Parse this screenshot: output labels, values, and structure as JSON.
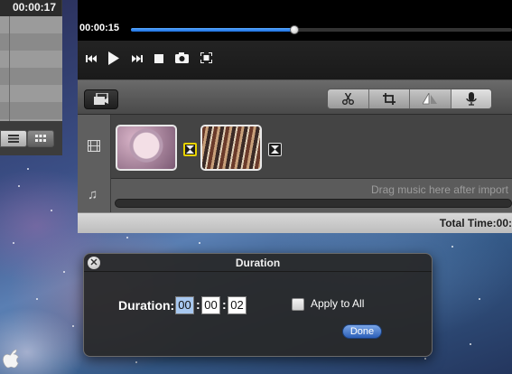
{
  "library": {
    "time": "00:00:17",
    "view_list_icon": "list-view-icon",
    "view_grid_icon": "grid-view-icon"
  },
  "player": {
    "current_time": "00:00:15",
    "progress": 0.43,
    "controls": [
      "previous-icon",
      "play-icon",
      "next-icon",
      "stop-icon",
      "camera-icon",
      "fullscreen-icon"
    ]
  },
  "toolbar": {
    "media_icon": "media-browser-icon",
    "tools": [
      "scissors-icon",
      "crop-icon",
      "effects-icon",
      "microphone-icon"
    ]
  },
  "timeline": {
    "music_hint": "Drag music here after import",
    "total_time_label": "Total Time:00:"
  },
  "duration_dialog": {
    "title": "Duration",
    "label": "Duration:",
    "hours": "00",
    "minutes": "00",
    "seconds": "02",
    "apply_all_label": "Apply to All",
    "apply_all_checked": false,
    "done_label": "Done"
  },
  "colors": {
    "accent": "#1a6fe0",
    "selection_outline": "#e8d200"
  }
}
